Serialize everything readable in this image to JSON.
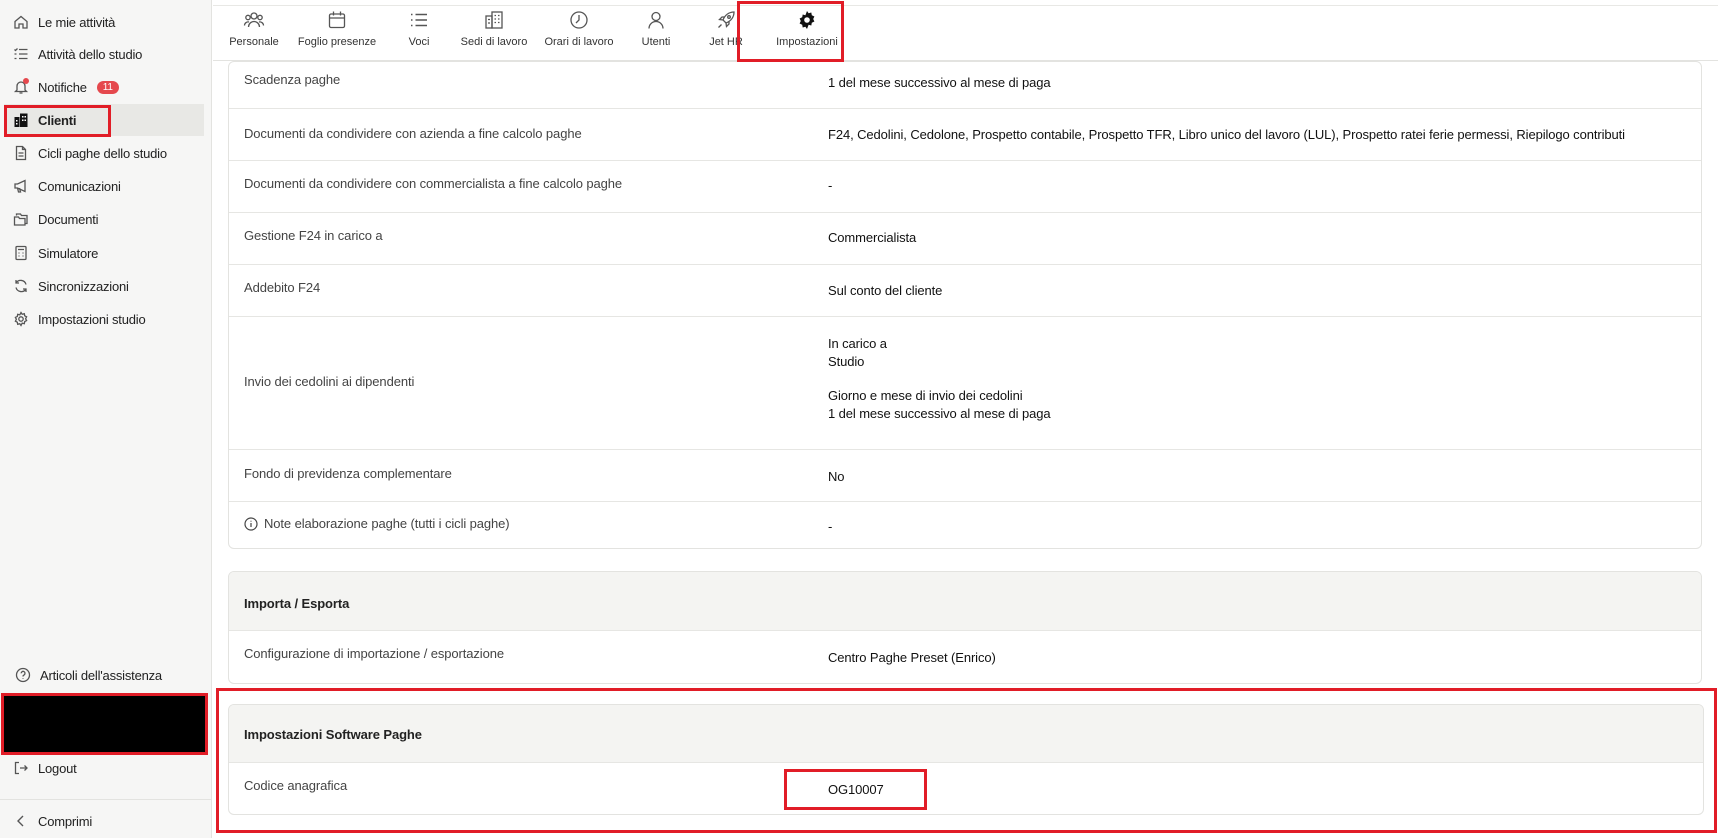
{
  "sidebar": {
    "items": [
      {
        "label": "Le mie attività",
        "icon": "home-icon"
      },
      {
        "label": "Attività dello studio",
        "icon": "checklist-icon"
      },
      {
        "label": "Notifiche",
        "icon": "bell-icon",
        "badge": "11"
      },
      {
        "label": "Clienti",
        "icon": "building-icon"
      },
      {
        "label": "Cicli paghe dello studio",
        "icon": "document-icon"
      },
      {
        "label": "Comunicazioni",
        "icon": "megaphone-icon"
      },
      {
        "label": "Documenti",
        "icon": "folder-icon"
      },
      {
        "label": "Simulatore",
        "icon": "calculator-icon"
      },
      {
        "label": "Sincronizzazioni",
        "icon": "sync-icon"
      },
      {
        "label": "Impostazioni studio",
        "icon": "gear-icon"
      }
    ],
    "help": "Articoli dell'assistenza",
    "logout": "Logout",
    "collapse": "Comprimi"
  },
  "tabs": [
    {
      "label": "Personale",
      "icon": "people-icon"
    },
    {
      "label": "Foglio presenze",
      "icon": "calendar-icon"
    },
    {
      "label": "Voci",
      "icon": "list-icon"
    },
    {
      "label": "Sedi di lavoro",
      "icon": "office-building-icon"
    },
    {
      "label": "Orari di lavoro",
      "icon": "clock-icon"
    },
    {
      "label": "Utenti",
      "icon": "user-icon"
    },
    {
      "label": "Jet HR",
      "icon": "rocket-icon"
    },
    {
      "label": "Impostazioni",
      "icon": "gear-icon"
    }
  ],
  "settings": {
    "rows": [
      {
        "label": "Scadenza paghe",
        "value": "1 del mese successivo al mese di paga"
      },
      {
        "label": "Documenti da condividere con azienda a fine calcolo paghe",
        "value": "F24, Cedolini, Cedolone, Prospetto contabile, Prospetto TFR, Libro unico del lavoro (LUL), Prospetto ratei ferie permessi, Riepilogo contributi"
      },
      {
        "label": "Documenti da condividere con commercialista a fine calcolo paghe",
        "value": "-"
      },
      {
        "label": "Gestione F24 in carico a",
        "value": "Commercialista"
      },
      {
        "label": "Addebito F24",
        "value": "Sul conto del cliente"
      }
    ],
    "payslip": {
      "label": "Invio dei cedolini ai dipendenti",
      "sub1_label": "In carico a",
      "sub1_value": "Studio",
      "sub2_label": "Giorno e mese di invio dei cedolini",
      "sub2_value": "1 del mese successivo al mese di paga"
    },
    "pension": {
      "label": "Fondo di previdenza complementare",
      "value": "No"
    },
    "notes": {
      "label": "Note elaborazione paghe (tutti i cicli paghe)",
      "value": "-"
    }
  },
  "import_export": {
    "title": "Importa / Esporta",
    "label": "Configurazione di importazione / esportazione",
    "value": "Centro Paghe Preset (Enrico)"
  },
  "software": {
    "title": "Impostazioni Software Paghe",
    "label": "Codice anagrafica",
    "value": "OG10007"
  },
  "colors": {
    "highlight": "#e11d27",
    "badge": "#e5484d",
    "sidebar_bg": "#f6f6f5"
  }
}
